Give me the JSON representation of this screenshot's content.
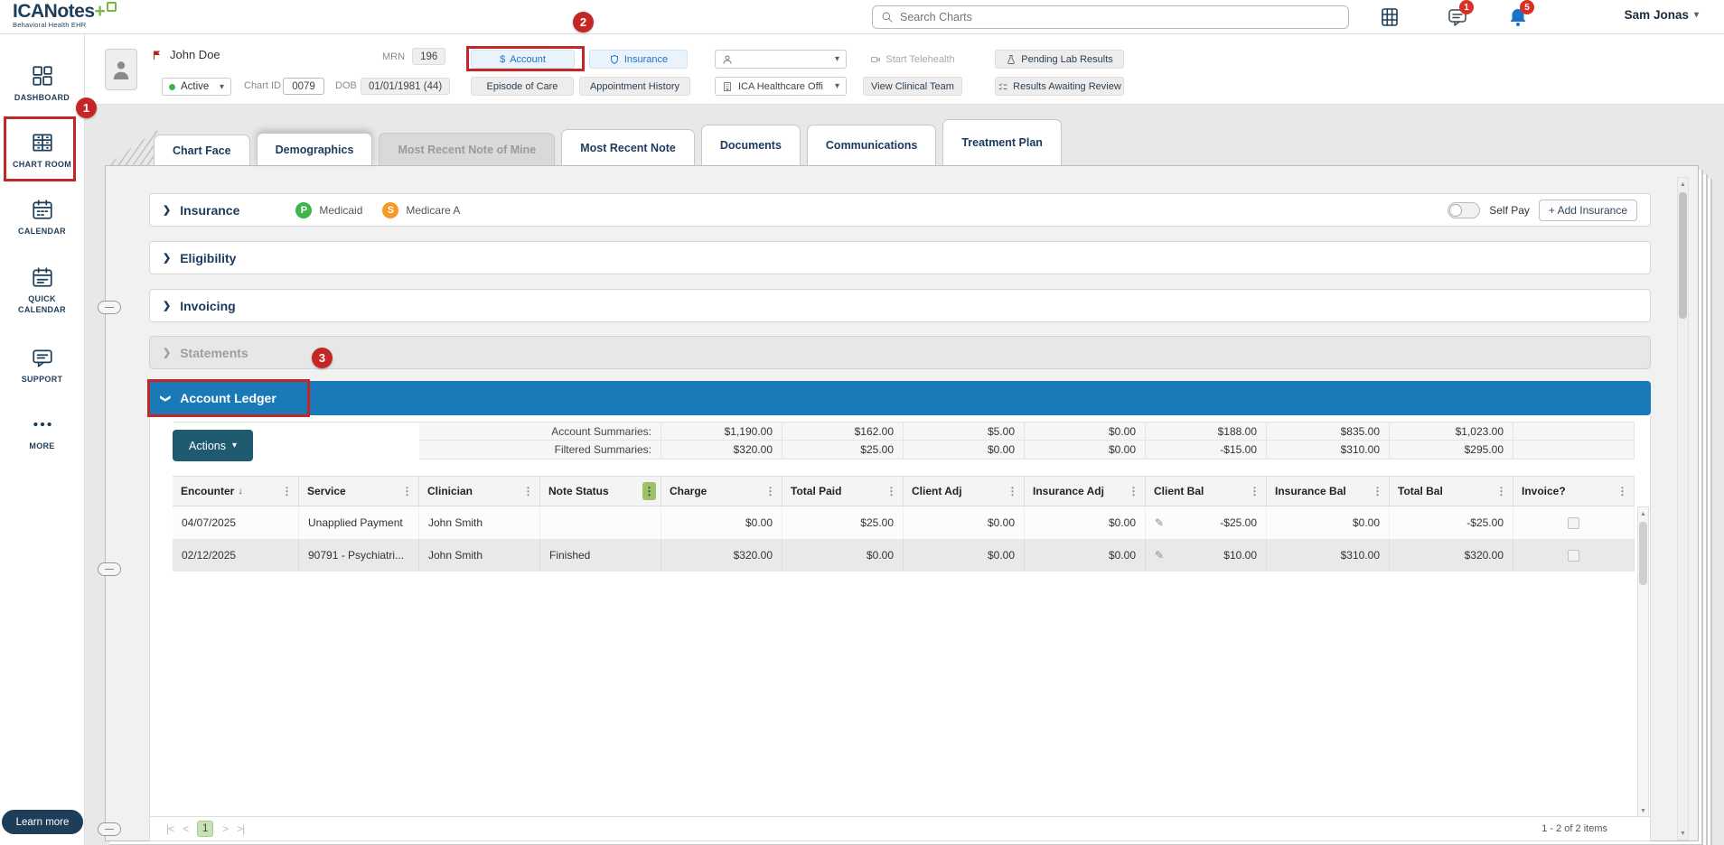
{
  "colors": {
    "navy": "#1e3d59",
    "ledger_blue": "#1a7ab8",
    "link_blue": "#1a73c8",
    "annotation_red": "#c42525",
    "medicaid_green": "#3cb54b",
    "medicare_orange": "#f59a23",
    "actions_button": "#205a70",
    "logo_green": "#7ab648"
  },
  "annotations": {
    "badge1": "1",
    "badge2": "2",
    "badge3": "3"
  },
  "topbar": {
    "logo_text": "ICANotes",
    "logo_plus": "+",
    "logo_tagline": "Behavioral Health EHR",
    "search_placeholder": "Search Charts",
    "chat_badge": "1",
    "bell_badge": "5",
    "user_name": "Sam Jonas"
  },
  "sidebar": {
    "items": [
      {
        "label": "DASHBOARD"
      },
      {
        "label": "CHART ROOM"
      },
      {
        "label": "CALENDAR"
      },
      {
        "label": "QUICK CALENDAR"
      },
      {
        "label": "SUPPORT"
      },
      {
        "label": "MORE"
      }
    ],
    "learn_more_label": "Learn more"
  },
  "patient": {
    "name": "John Doe",
    "mrn_label": "MRN",
    "mrn_value": "196",
    "status_value": "Active",
    "chart_id_label": "Chart ID",
    "chart_id_value": "0079",
    "dob_label": "DOB",
    "dob_value": "01/01/1981 (44)",
    "account_button": "Account",
    "insurance_button": "Insurance",
    "episode_of_care_button": "Episode of Care",
    "appointment_history_button": "Appointment History",
    "office_select_value": "ICA Healthcare Offi",
    "start_telehealth_button": "Start Telehealth",
    "view_clinical_team_button": "View Clinical Team",
    "pending_lab_results_button": "Pending Lab Results",
    "results_awaiting_review_button": "Results Awaiting Review"
  },
  "tabs": [
    {
      "label": "Chart Face"
    },
    {
      "label": "Demographics"
    },
    {
      "label": "Most Recent Note of Mine"
    },
    {
      "label": "Most Recent Note"
    },
    {
      "label": "Documents"
    },
    {
      "label": "Communications"
    },
    {
      "label": "Treatment Plan"
    }
  ],
  "sections": {
    "insurance": {
      "title": "Insurance",
      "plans": [
        {
          "badge": "P",
          "name": "Medicaid"
        },
        {
          "badge": "S",
          "name": "Medicare A"
        }
      ],
      "self_pay_label": "Self Pay",
      "add_insurance_button": "+ Add Insurance"
    },
    "eligibility": {
      "title": "Eligibility"
    },
    "invoicing": {
      "title": "Invoicing"
    },
    "statements": {
      "title": "Statements"
    },
    "account_ledger": {
      "title": "Account Ledger"
    }
  },
  "ledger": {
    "actions_button": "Actions",
    "summary_rows": [
      {
        "label": "Account Summaries:",
        "values": [
          "$1,190.00",
          "$162.00",
          "$5.00",
          "$0.00",
          "$188.00",
          "$835.00",
          "$1,023.00"
        ]
      },
      {
        "label": "Filtered Summaries:",
        "values": [
          "$320.00",
          "$25.00",
          "$0.00",
          "$0.00",
          "-$15.00",
          "$310.00",
          "$295.00"
        ]
      }
    ],
    "columns": [
      "Encounter",
      "Service",
      "Clinician",
      "Note Status",
      "Charge",
      "Total Paid",
      "Client Adj",
      "Insurance Adj",
      "Client Bal",
      "Insurance Bal",
      "Total Bal",
      "Invoice?"
    ],
    "rows": [
      {
        "encounter": "04/07/2025",
        "service": "Unapplied Payment",
        "clinician": "John Smith",
        "note_status": "",
        "charge": "$0.00",
        "total_paid": "$25.00",
        "client_adj": "$0.00",
        "insurance_adj": "$0.00",
        "client_bal": "-$25.00",
        "insurance_bal": "$0.00",
        "total_bal": "-$25.00"
      },
      {
        "encounter": "02/12/2025",
        "service": "90791 - Psychiatri...",
        "clinician": "John Smith",
        "note_status": "Finished",
        "charge": "$320.00",
        "total_paid": "$0.00",
        "client_adj": "$0.00",
        "insurance_adj": "$0.00",
        "client_bal": "$10.00",
        "insurance_bal": "$310.00",
        "total_bal": "$320.00"
      }
    ],
    "pagination": {
      "current_page": "1",
      "range_text": "1 - 2 of 2 items"
    }
  }
}
